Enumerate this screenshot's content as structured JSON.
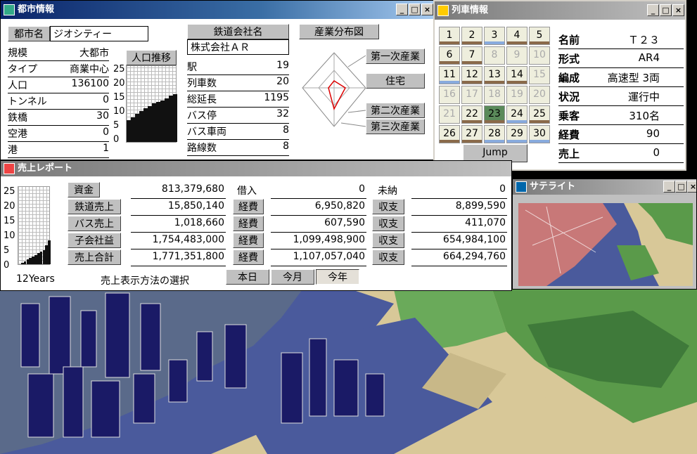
{
  "city": {
    "title": "都市情報",
    "name_label": "都市名",
    "name_value": "ジオシティー",
    "stats": [
      {
        "label": "規模",
        "value": "大都市"
      },
      {
        "label": "タイプ",
        "value": "商業中心"
      },
      {
        "label": "人口",
        "value": "136100"
      },
      {
        "label": "トンネル",
        "value": "0"
      },
      {
        "label": "鉄橋",
        "value": "30"
      },
      {
        "label": "空港",
        "value": "0"
      },
      {
        "label": "港",
        "value": "1"
      }
    ],
    "pop_button": "人口推移",
    "pop_axis": [
      "25",
      "20",
      "15",
      "10",
      "5",
      "0"
    ],
    "pop_chart_fraction": [
      0.28,
      0.32,
      0.36,
      0.4,
      0.44,
      0.46,
      0.5,
      0.52,
      0.54,
      0.56,
      0.6,
      0.62
    ],
    "company_label": "鉄道会社名",
    "company_value": "株式会社ＡＲ",
    "rail_stats": [
      {
        "label": "駅",
        "value": "19"
      },
      {
        "label": "列車数",
        "value": "20"
      },
      {
        "label": "総延長",
        "value": "1195"
      },
      {
        "label": "バス停",
        "value": "32"
      },
      {
        "label": "バス車両",
        "value": "8"
      },
      {
        "label": "路線数",
        "value": "8"
      }
    ],
    "industry_button": "産業分布図",
    "industry_labels": [
      "第一次産業",
      "住宅",
      "第二次産業",
      "第三次産業"
    ]
  },
  "train": {
    "title": "列車情報",
    "cells": [
      "1",
      "2",
      "3",
      "4",
      "5",
      "6",
      "7",
      "8",
      "9",
      "10",
      "11",
      "12",
      "13",
      "14",
      "15",
      "16",
      "17",
      "18",
      "19",
      "20",
      "21",
      "22",
      "23",
      "24",
      "25",
      "26",
      "27",
      "28",
      "29",
      "30"
    ],
    "jump": "Jump",
    "fields": [
      {
        "label": "名前",
        "value": "Ｔ２３"
      },
      {
        "label": "形式",
        "value": "AR4"
      },
      {
        "label": "編成",
        "value": "高速型 3両"
      },
      {
        "label": "状況",
        "value": "運行中"
      },
      {
        "label": "乗客",
        "value": "310名"
      },
      {
        "label": "経費",
        "value": "90"
      },
      {
        "label": "売上",
        "value": "0"
      }
    ]
  },
  "sales": {
    "title": "売上レポート",
    "axis": [
      "25",
      "20",
      "15",
      "10",
      "5",
      "0"
    ],
    "years": "12Years",
    "mode_label": "売上表示方法の選択",
    "periods": [
      "本日",
      "今月",
      "今年"
    ],
    "chart_fraction": [
      0.0,
      0.02,
      0.04,
      0.06,
      0.08,
      0.1,
      0.12,
      0.14,
      0.16,
      0.18,
      0.24,
      0.3
    ],
    "rows": [
      {
        "l1": "資金",
        "v1": "813,379,680",
        "l2": "借入",
        "v2": "0",
        "l3": "未納",
        "v3": "0"
      },
      {
        "l1": "鉄道売上",
        "v1": "15,850,140",
        "l2": "経費",
        "v2": "6,950,820",
        "l3": "収支",
        "v3": "8,899,590"
      },
      {
        "l1": "バス売上",
        "v1": "1,018,660",
        "l2": "経費",
        "v2": "607,590",
        "l3": "収支",
        "v3": "411,070"
      },
      {
        "l1": "子会社益",
        "v1": "1,754,483,000",
        "l2": "経費",
        "v2": "1,099,498,900",
        "l3": "収支",
        "v3": "654,984,100"
      },
      {
        "l1": "売上合計",
        "v1": "1,771,351,800",
        "l2": "経費",
        "v2": "1,107,057,040",
        "l3": "収支",
        "v3": "664,294,760"
      }
    ]
  },
  "satellite": {
    "title": "サテライト"
  },
  "colors": {
    "title_active": "#0a246a",
    "title_inactive": "#808080",
    "panel": "#c0c0c0",
    "water": "#4a5a9c",
    "sand": "#d8c898",
    "grass": "#5a9a4a"
  }
}
